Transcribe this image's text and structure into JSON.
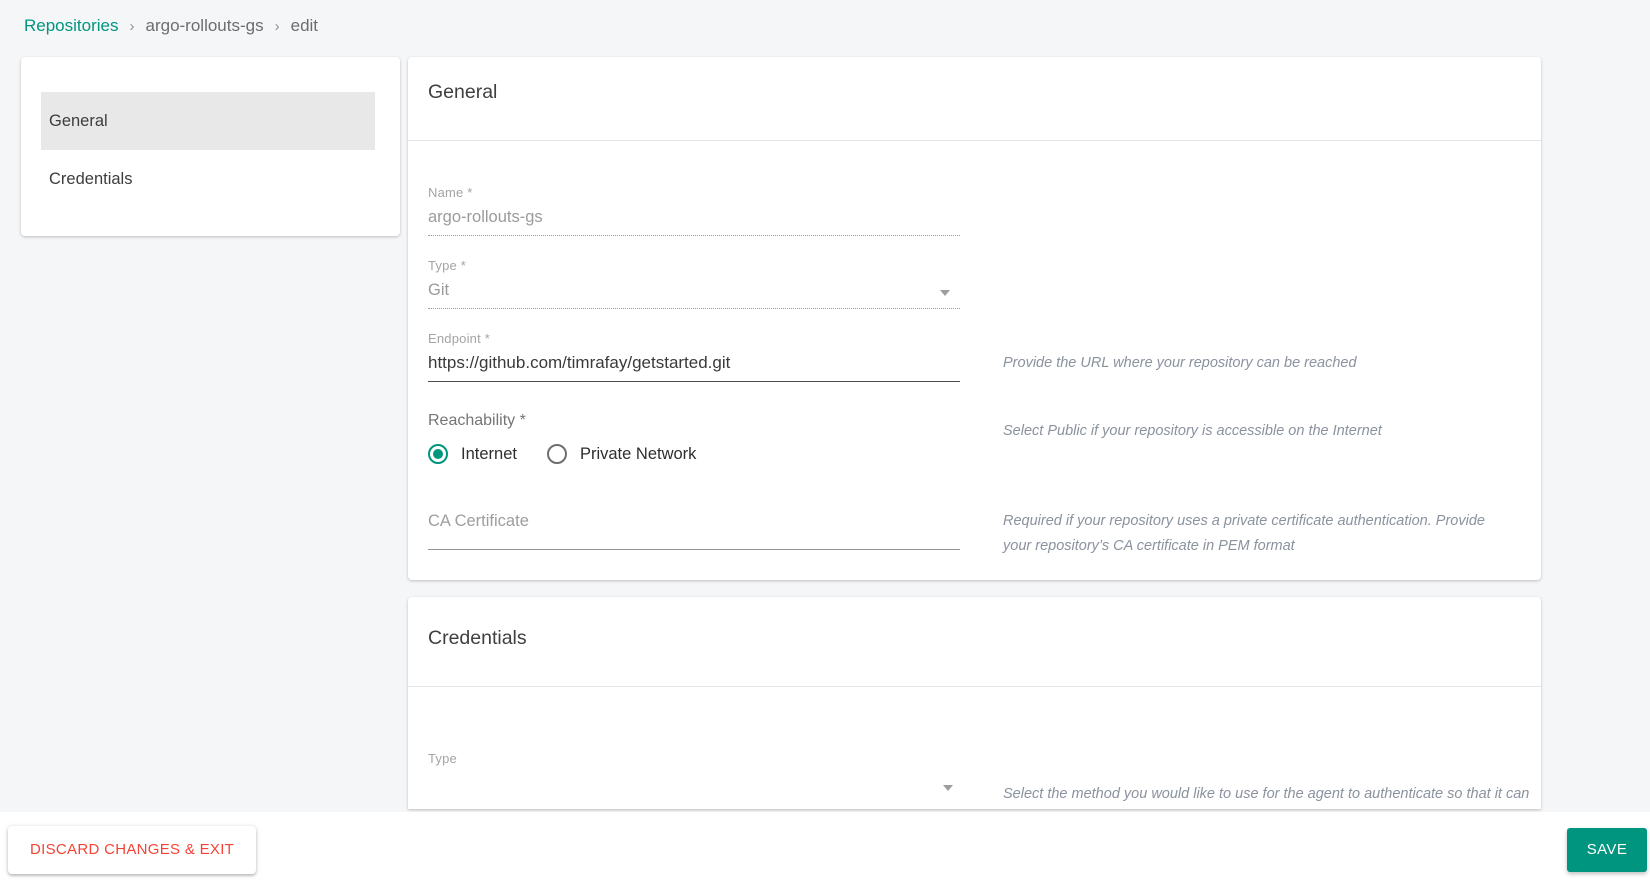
{
  "colors": {
    "accent_teal": "#00957f",
    "danger_red": "#f44336",
    "page_background": "#f5f6f8",
    "active_item_background": "#e8e8e8"
  },
  "breadcrumb": {
    "separator": "›",
    "items": [
      {
        "label": "Repositories",
        "type": "link"
      },
      {
        "label": "argo-rollouts-gs",
        "type": "crumb"
      },
      {
        "label": "edit",
        "type": "current"
      }
    ]
  },
  "sidebar": {
    "items": [
      {
        "label": "General",
        "active": true
      },
      {
        "label": "Credentials",
        "active": false
      }
    ]
  },
  "general_panel": {
    "title": "General",
    "fields": {
      "name": {
        "label": "Name *",
        "value": "argo-rollouts-gs",
        "disabled": true
      },
      "type": {
        "label": "Type *",
        "value": "Git",
        "disabled": true
      },
      "endpoint": {
        "label": "Endpoint *",
        "value": "https://github.com/timrafay/getstarted.git",
        "helper": "Provide the URL where your repository can be reached"
      },
      "reachability": {
        "label": "Reachability *",
        "options": [
          {
            "label": "Internet",
            "selected": true
          },
          {
            "label": "Private Network",
            "selected": false
          }
        ],
        "helper": "Select Public if your repository is accessible on the Internet"
      },
      "ca_certificate": {
        "label": "CA Certificate",
        "value": "",
        "helper": "Required if your repository uses a private certificate authentication. Provide your repository’s CA certificate in PEM format"
      }
    }
  },
  "credentials_panel": {
    "title": "Credentials",
    "fields": {
      "type": {
        "label": "Type",
        "helper": "Select the method you would like to use for the agent to authenticate so that it can"
      }
    }
  },
  "footer": {
    "discard_label": "DISCARD CHANGES & EXIT",
    "save_label": "SAVE"
  }
}
